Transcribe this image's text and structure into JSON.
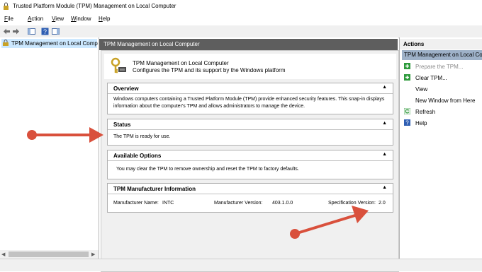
{
  "window": {
    "title": "Trusted Platform Module (TPM) Management on Local Computer"
  },
  "menu": [
    {
      "label": "File",
      "ul": "F",
      "rest": "ile"
    },
    {
      "label": "Action",
      "ul": "A",
      "rest": "ction"
    },
    {
      "label": "View",
      "ul": "V",
      "rest": "iew"
    },
    {
      "label": "Window",
      "ul": "W",
      "rest": "indow"
    },
    {
      "label": "Help",
      "ul": "H",
      "rest": "elp"
    }
  ],
  "tree": {
    "selected_label": "TPM Management on Local Comp"
  },
  "center": {
    "header": "TPM Management on Local Computer",
    "banner_title": "TPM Management on Local Computer",
    "banner_sub": "Configures the TPM and its support by the Windows platform",
    "overview": {
      "title": "Overview",
      "line1": "Windows computers containing a Trusted Platform Module (TPM) provide enhanced security features. This snap-in displays",
      "line2": "information about the computer's TPM and allows administrators to manage the device."
    },
    "status": {
      "title": "Status",
      "text": "The TPM is ready for use."
    },
    "options": {
      "title": "Available Options",
      "text": "You may clear the TPM to remove ownership and reset the TPM to factory defaults."
    },
    "manufacturer": {
      "title": "TPM Manufacturer Information",
      "name_label": "Manufacturer Name:",
      "name_value": "INTC",
      "version_label": "Manufacturer Version:",
      "version_value": "403.1.0.0",
      "spec_label": "Specification Version:",
      "spec_value": "2.0"
    },
    "collapse_glyph": "▲"
  },
  "actions": {
    "title": "Actions",
    "selected": "TPM Management on Local Co",
    "items": [
      {
        "label": "Prepare the TPM...",
        "icon": "green-plus-icon",
        "disabled": true
      },
      {
        "label": "Clear TPM...",
        "icon": "green-plus-icon",
        "disabled": false
      },
      {
        "label": "View",
        "icon": "none",
        "disabled": false
      },
      {
        "label": "New Window from Here",
        "icon": "none",
        "disabled": false
      },
      {
        "label": "Refresh",
        "icon": "refresh-icon",
        "disabled": false
      },
      {
        "label": "Help",
        "icon": "help-icon",
        "disabled": false
      }
    ]
  },
  "colors": {
    "arrow": "#d9503c",
    "section_header": "#5e5e5e",
    "selection": "#9eb1c8"
  }
}
